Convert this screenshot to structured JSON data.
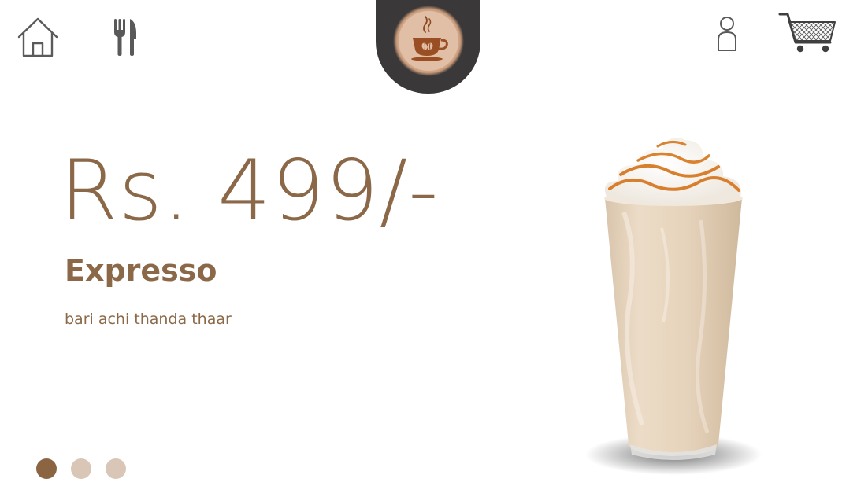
{
  "nav": {
    "home_icon": "home-icon",
    "menu_icon": "utensils-icon",
    "logo_icon": "coffee-cup-icon",
    "account_icon": "user-icon",
    "cart_icon": "shopping-cart-icon"
  },
  "product": {
    "price": "Rs. 499/-",
    "name": "Expresso",
    "description": "bari achi thanda thaar"
  },
  "carousel": {
    "count": 3,
    "active_index": 0
  },
  "colors": {
    "accent_brown": "#8b6848",
    "tab_dark": "#3a3838",
    "dot_active": "#8b6442",
    "dot_inactive": "#d9c6b6"
  }
}
